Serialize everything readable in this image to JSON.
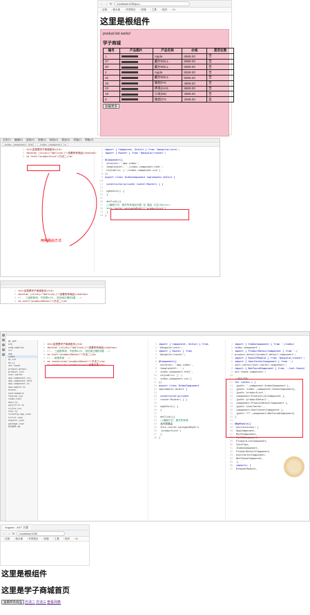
{
  "top_browser": {
    "url": "localhost:4200/pro...",
    "bookmarks": [
      "应用",
      "新大事",
      "开发笔记",
      "前端",
      "工具",
      "知识",
      "AI"
    ]
  },
  "top_page": {
    "heading": "这里是根组件",
    "product_list_text": "product-list works!",
    "shop_title": "学子商城",
    "columns": [
      "编号",
      "产品图片",
      "产品名称",
      "价格",
      "是否在售"
    ],
    "rows": [
      {
        "id": "1",
        "name": "Apple",
        "price": "6988.00",
        "on_sale": "否"
      },
      {
        "id": "27",
        "name": "戴尔DELL",
        "price": "5999.00",
        "on_sale": "否"
      },
      {
        "id": "20",
        "name": "戴尔DELL",
        "price": "6599.00",
        "on_sale": "否"
      },
      {
        "id": "2",
        "name": "Apple",
        "price": "8268.00",
        "on_sale": "否"
      },
      {
        "id": "22",
        "name": "戴尔DELL",
        "price": "6999.00",
        "on_sale": "否"
      },
      {
        "id": "29",
        "name": "联想(TN",
        "price": "4699.00",
        "on_sale": "否"
      },
      {
        "id": "43",
        "name": "神舟(HAS",
        "price": "5699.00",
        "on_sale": "否"
      },
      {
        "id": "19",
        "name": "小米(MI)",
        "price": "4999.00",
        "on_sale": "否"
      },
      {
        "id": "9",
        "name": "联想(TN",
        "price": "3499.00",
        "on_sale": "是"
      }
    ],
    "load_more": "加载更多"
  },
  "ide1": {
    "menu": [
      "文件(F)",
      "编辑(E)",
      "选择(S)",
      "查看(V)",
      "转到(G)",
      "调试(D)",
      "终端(T)",
      "帮助(H)"
    ],
    "tabs": [
      "index.component.html",
      "index.component.ts"
    ],
    "html_lines": [
      "<h1>这里是学子商城首页</h1>",
      "<button (click)=\"doClick()\">查看所有商品</button>",
      "<a href=\"productList\">方法二</a>"
    ],
    "ts_lines": [
      "import { Component, OnInit } from '@angular/core';",
      "import { Router } from '@angular/router';",
      "",
      "@Component({",
      "  selector: 'app-index',",
      "  templateUrl: './index.component.html',",
      "  styleUrls: ['./index.component.css']",
      "})",
      "export class IndexComponent implements OnInit {",
      "",
      "  constructor(private router:Router) { }",
      "",
      "  ngOnInit() {",
      "  }",
      "",
      "  doClick(){",
      "    //编程方式：离开所有商品列表 自 路由 方法(Router)",
      "    this.router.navigateByUrl('productList')",
      "  }",
      "}"
    ],
    "note": "两种路由方法"
  },
  "ide2": {
    "html_lines": [
      "<h1>这里是学子商城首页</h1>",
      "<button (click)=\"doClick()\">查看所有商品</button>",
      "<!-- 三级推荐用，不用再a(R), 用页面正确的8重 -->",
      "<a href=\"productDetail\">方法二</a>"
    ]
  },
  "ide3": {
    "html_lines": [
      "<h1>这里是学子商城首页</h1>",
      "<button (click)=\"doClick()\">查看所有商品</button>",
      "<!-- 三级推荐用，不用再a(R)，用页面正确的8重 -->",
      "<a href=\"productDetail\">方法二</a>",
      "<!-- 新推荐用 -->",
      "<a routerLink=\"productDetail\">方法三</a>",
      "<a routerLink=\"productList\">查看列表</a>"
    ],
    "ts_lines": [
      "import { Component, OnInit } from",
      "'@angular/core';",
      "import { Router } from",
      "'@angular/router';",
      "",
      "@Component({",
      "  selector: 'app-index',",
      "  templateUrl: './",
      "  index.component.html',",
      "  styleUrls: ['./",
      "  index.component.css']",
      "})",
      "export class IndexComponent",
      "implements OnInit {",
      "",
      "  constructor(private",
      "  router:Router) { }",
      "",
      "  ngOnInit() {",
      "  }",
      "",
      "  doClick(){",
      "    //编程方式：离开所有商",
      "    品列表路由",
      "    this.router.navigateByUrl(",
      "    'productList')",
      "  }",
      "}"
    ],
    "module_lines": [
      "import { IndexComponent } from './index/",
      "index.component';",
      "import { ProductDetailComponent } from './",
      "product-detail/product-detail.component';",
      "import { RouterModule } from '@angular/router';",
      "import { UserCenterComponent } from './",
      "user-center/user-center.component';",
      "import { NotFoundComponent } from './not-found/",
      "not-found.component';",
      "",
      "//路由词典",
      "let routes = [",
      "  {path:'',component:IndexComponent },",
      "  {path:'index',component:IndexComponent},",
      "  {path:'productList',",
      "  component:ProductListComponent },",
      "  {path:'productDetail',",
      "  component:ProductDetailComponent },",
      "  {path:'userCenter',",
      "  component:UserCenterComponent },",
      "  {path:'**',component:NotFoundComponent}",
      "]",
      "",
      "@NgModule({",
      "  declarations: [",
      "    AppComponent,",
      "    MyJSComponent,",
      "    MyCSSComponent,",
      "    ProductListComponent,",
      "    SaleTips,",
      "    IndexComponent,",
      "    ProductDetailComponent,",
      "    UserCenterComponent,",
      "    NotFoundComponent,",
      "  ],",
      "  imports: [",
      "    BrowserModule,"
    ],
    "tree_items": [
      "MY-APP",
      "e2e",
      "node_modules",
      "src",
      "app",
      "index",
      "my-css",
      "my-js",
      "not-found",
      "product-detail",
      "product-list",
      "user-center",
      "app.component.css",
      "app.component.html",
      "app.component.ts",
      "app.module.ts",
      "assets",
      "environments",
      "favicon.ico",
      "index.html",
      "main.ts",
      "polyfills.ts",
      "styles.css",
      "test.ts",
      "tsconfig.app.json",
      "tslint.json",
      "angular.json",
      "package.json",
      "README.md"
    ]
  },
  "bottom_browser": {
    "tab_title": "Angular - AST 大理",
    "url": "localhost:4200",
    "bookmarks": [
      "应用",
      "新大事",
      "开发笔记",
      "前端",
      "工具",
      "知识",
      "AI"
    ]
  },
  "bottom_page": {
    "root_heading": "这里是根组件",
    "index_heading": "这里是学子商城首页",
    "button_label": "查看所有商品",
    "link2": "方法二",
    "link3": "方法三",
    "link4": "查看列表"
  }
}
